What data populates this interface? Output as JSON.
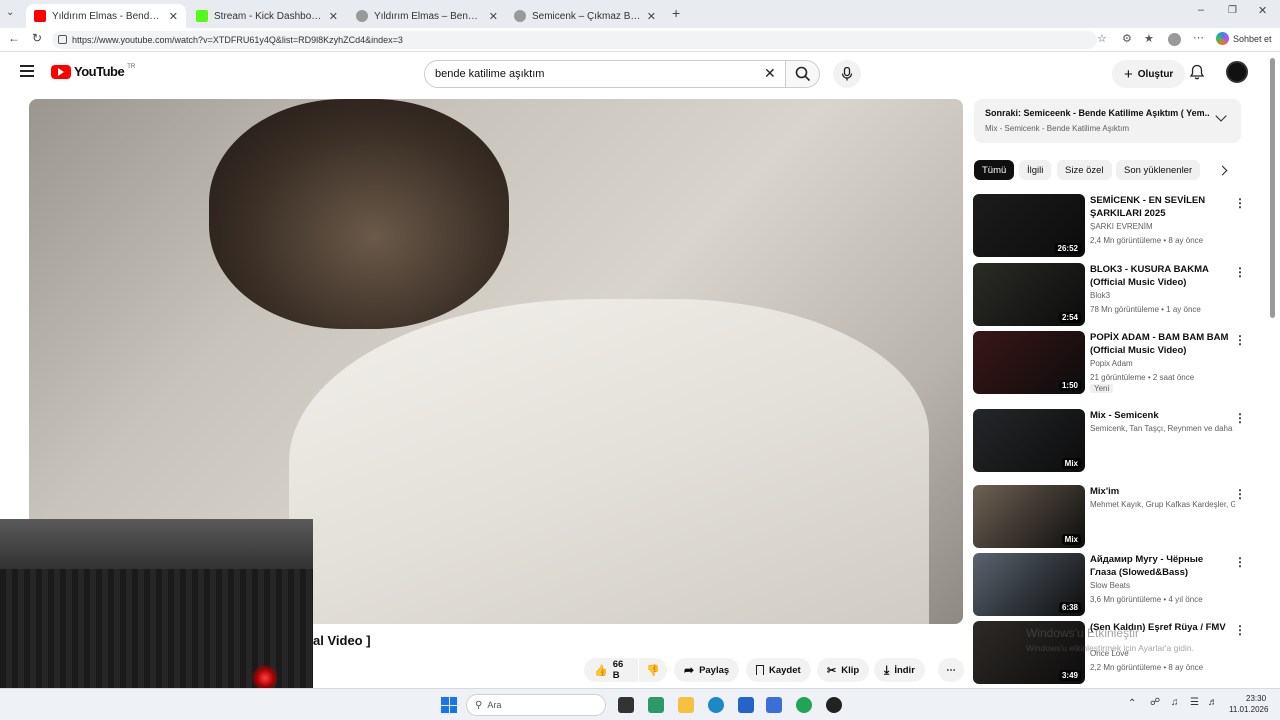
{
  "browser": {
    "tabs": [
      {
        "title": "Yıldırım Elmas - Bende Katilim",
        "fav": "#ff0000",
        "active": true
      },
      {
        "title": "Stream - Kick Dashboard",
        "fav": "#53fc18",
        "active": false
      },
      {
        "title": "Yıldırım Elmas – Bende Katilime Aşı",
        "fav": "#777777",
        "active": false
      },
      {
        "title": "Semicenk – Çıkmaz Bir Sokakta Lyr",
        "fav": "#777777",
        "active": false
      }
    ],
    "url": "https://www.youtube.com/watch?v=XTDFRU61y4Q&list=RD9l8KzyhZCd4&index=3",
    "copilot_label": "Sohbet et"
  },
  "youtube": {
    "logo": "YouTube",
    "region": "TR",
    "search_value": "bende katilime aşıktım",
    "create_label": "Oluştur"
  },
  "video": {
    "title_fragment": "al Video ]",
    "actions": {
      "like": "66 B",
      "share": "Paylaş",
      "save": "Kaydet",
      "clip": "Klip",
      "download": "İndir"
    }
  },
  "playlist": {
    "next_label": "Sonraki: Semiceenk - Bende Katilime Aşıktım ( Yem...",
    "mix_label": "Mix - Semicenk - Bende Katilime Aşıktım"
  },
  "chips": [
    "Tümü",
    "İlgili",
    "Size özel",
    "Son yüklenenler"
  ],
  "recommendations": [
    {
      "title": "SEMİCENK - EN SEVİLEN ŞARKILARI 2025",
      "channel": "ŞARKI EVRENİM",
      "meta": "2,4 Mn görüntüleme • 8 ay önce",
      "badge": "",
      "duration": "26:52",
      "color": "#1c1c1c"
    },
    {
      "title": "BLOK3 - KUSURA BAKMA (Official Music Video)",
      "channel": "Blok3",
      "meta": "78 Mn görüntüleme • 1 ay önce",
      "badge": "",
      "duration": "2:54",
      "color": "#2a2c26"
    },
    {
      "title": "POPİX ADAM - BAM BAM BAM (Official Music Video)",
      "channel": "Popix Adam",
      "meta": "21 görüntüleme • 2 saat önce",
      "badge": "Yeni",
      "duration": "1:50",
      "color": "#3a1618"
    },
    {
      "title": "Mix - Semicenk",
      "channel": "Semicenk, Tan Taşçı, Reynmen ve daha f...",
      "meta": "",
      "badge": "",
      "duration": "Mix",
      "color": "#24272a"
    },
    {
      "title": "Mix'im",
      "channel": "Mehmet Kayık, Grup Kafkas Kardeşler, G...",
      "meta": "",
      "badge": "",
      "duration": "Mix",
      "color": "#6f6254"
    },
    {
      "title": "Айдамир Мугу - Чёрные Глаза (Slowed&Bass)",
      "channel": "Slow Beats",
      "meta": "3,6 Mn görüntüleme • 4 yıl önce",
      "badge": "",
      "duration": "6:38",
      "color": "#5a6470"
    },
    {
      "title": "(Sen Kaldın) Eşref Rüya / FMV",
      "channel": "Once Love",
      "meta": "2,2 Mn görüntüleme • 8 ay önce",
      "badge": "",
      "duration": "3:49",
      "color": "#2e2a26"
    }
  ],
  "watermark": {
    "line1": "Windows'u Etkinleştir",
    "line2": "Windows'u etkinleştirmek için Ayarlar'a gidin."
  },
  "taskbar": {
    "search_placeholder": "Ara",
    "time": "23:30",
    "date": "11.01.2026"
  }
}
